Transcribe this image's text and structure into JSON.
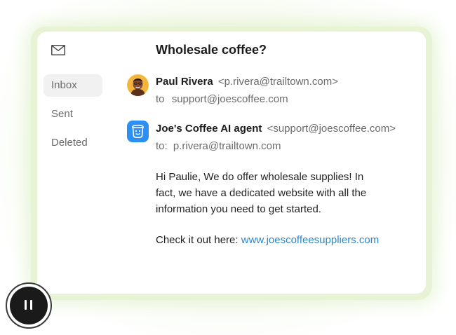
{
  "sidebar": {
    "icon": "mail-icon",
    "items": [
      {
        "label": "Inbox",
        "active": true
      },
      {
        "label": "Sent",
        "active": false
      },
      {
        "label": "Deleted",
        "active": false
      }
    ]
  },
  "email": {
    "subject": "Wholesale coffee?",
    "messages": [
      {
        "sender_name": "Paul Rivera",
        "sender_address": "<p.rivera@trailtown.com>",
        "to_prefix": "to",
        "to_address": "support@joescoffee.com",
        "avatar": "person-avatar"
      },
      {
        "sender_name": "Joe's Coffee AI agent",
        "sender_address": "<support@joescoffee.com>",
        "to_prefix": "to:",
        "to_address": "p.rivera@trailtown.com",
        "avatar": "robot-icon"
      }
    ],
    "body": {
      "line1": "Hi Paulie, We do offer wholesale supplies! In",
      "line2": "fact, we have a dedicated website with all the",
      "line3": "information you need to get started.",
      "cta_text": "Check it out here:",
      "link_text": "www.joescoffeesuppliers.com"
    }
  },
  "controls": {
    "pause_icon": "pause-icon"
  },
  "colors": {
    "accent_link": "#2f86c7",
    "frame_green": "#e7f3d4",
    "ai_avatar_blue": "#2b8ff4"
  }
}
